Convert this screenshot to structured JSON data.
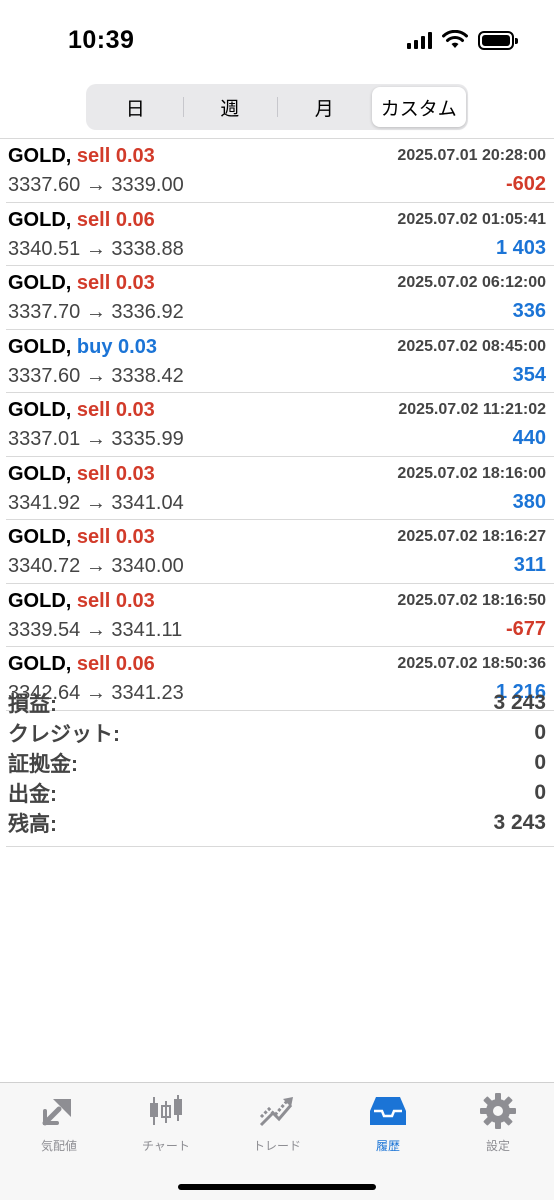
{
  "status": {
    "time": "10:39"
  },
  "segments": [
    "日",
    "週",
    "月",
    "カスタム"
  ],
  "trades": [
    {
      "symbol": "GOLD,",
      "side_type": "sell",
      "side": "sell 0.03",
      "time": "2025.07.01 20:28:00",
      "prices": "3337.60 → 3339.00",
      "profit": "-602",
      "profit_sign": "neg"
    },
    {
      "symbol": "GOLD,",
      "side_type": "sell",
      "side": "sell 0.06",
      "time": "2025.07.02 01:05:41",
      "prices": "3340.51 → 3338.88",
      "profit": "1 403",
      "profit_sign": "pos"
    },
    {
      "symbol": "GOLD,",
      "side_type": "sell",
      "side": "sell 0.03",
      "time": "2025.07.02 06:12:00",
      "prices": "3337.70 → 3336.92",
      "profit": "336",
      "profit_sign": "pos"
    },
    {
      "symbol": "GOLD,",
      "side_type": "buy",
      "side": "buy 0.03",
      "time": "2025.07.02 08:45:00",
      "prices": "3337.60 → 3338.42",
      "profit": "354",
      "profit_sign": "pos"
    },
    {
      "symbol": "GOLD,",
      "side_type": "sell",
      "side": "sell 0.03",
      "time": "2025.07.02 11:21:02",
      "prices": "3337.01 → 3335.99",
      "profit": "440",
      "profit_sign": "pos"
    },
    {
      "symbol": "GOLD,",
      "side_type": "sell",
      "side": "sell 0.03",
      "time": "2025.07.02 18:16:00",
      "prices": "3341.92 → 3341.04",
      "profit": "380",
      "profit_sign": "pos"
    },
    {
      "symbol": "GOLD,",
      "side_type": "sell",
      "side": "sell 0.03",
      "time": "2025.07.02 18:16:27",
      "prices": "3340.72 → 3340.00",
      "profit": "311",
      "profit_sign": "pos"
    },
    {
      "symbol": "GOLD,",
      "side_type": "sell",
      "side": "sell 0.03",
      "time": "2025.07.02 18:16:50",
      "prices": "3339.54 → 3341.11",
      "profit": "-677",
      "profit_sign": "neg"
    },
    {
      "symbol": "GOLD,",
      "side_type": "sell",
      "side": "sell 0.06",
      "time": "2025.07.02 18:50:36",
      "prices": "3342.64 → 3341.23",
      "profit": "1 216",
      "profit_sign": "pos"
    }
  ],
  "summary": [
    {
      "label": "損益:",
      "value": "3 243"
    },
    {
      "label": "クレジット:",
      "value": "0"
    },
    {
      "label": "証拠金:",
      "value": "0"
    },
    {
      "label": "出金:",
      "value": "0"
    },
    {
      "label": "残高:",
      "value": "3 243"
    }
  ],
  "tabs": [
    {
      "label": "気配値",
      "icon": "quotes-icon"
    },
    {
      "label": "チャート",
      "icon": "chart-icon"
    },
    {
      "label": "トレード",
      "icon": "trade-icon"
    },
    {
      "label": "履歴",
      "icon": "history-icon",
      "active": true
    },
    {
      "label": "設定",
      "icon": "settings-icon"
    }
  ],
  "colors": {
    "sell": "#d23b2a",
    "buy": "#1b74d6",
    "negative": "#d23b2a",
    "positive": "#1b74d6",
    "active_tab": "#1b74d6"
  }
}
